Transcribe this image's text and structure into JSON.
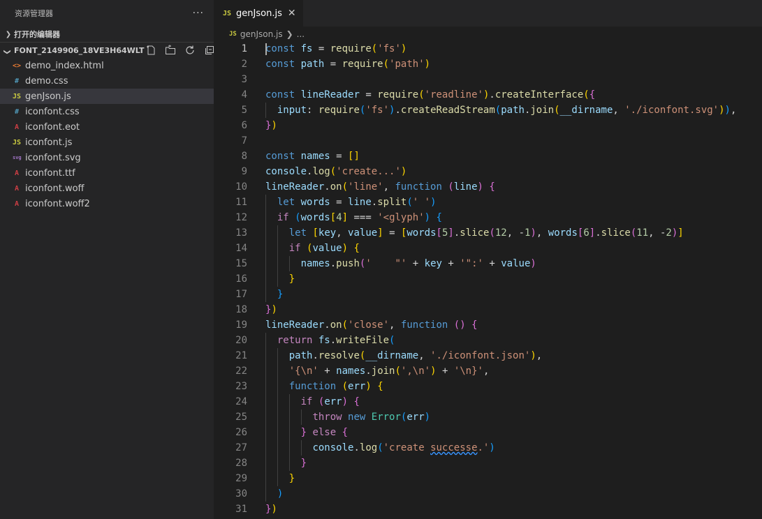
{
  "explorer": {
    "title": "资源管理器",
    "more": "···",
    "open_editors": "打开的编辑器",
    "folder_name": "FONT_2149906_18VE3H64WLT",
    "files": [
      {
        "name": "demo_index.html",
        "icon": "<>",
        "icon_color": "#e37933"
      },
      {
        "name": "demo.css",
        "icon": "#",
        "icon_color": "#519aba"
      },
      {
        "name": "genJson.js",
        "icon": "JS",
        "icon_color": "#cbcb41",
        "active": true
      },
      {
        "name": "iconfont.css",
        "icon": "#",
        "icon_color": "#519aba"
      },
      {
        "name": "iconfont.eot",
        "icon": "A",
        "icon_color": "#cc3e44"
      },
      {
        "name": "iconfont.js",
        "icon": "JS",
        "icon_color": "#cbcb41"
      },
      {
        "name": "iconfont.svg",
        "icon": "svg",
        "icon_color": "#a074c4"
      },
      {
        "name": "iconfont.ttf",
        "icon": "A",
        "icon_color": "#cc3e44"
      },
      {
        "name": "iconfont.woff",
        "icon": "A",
        "icon_color": "#cc3e44"
      },
      {
        "name": "iconfont.woff2",
        "icon": "A",
        "icon_color": "#cc3e44"
      }
    ]
  },
  "editor": {
    "tab_label": "genJson.js",
    "tab_icon": "JS",
    "breadcrumb_file": "genJson.js",
    "breadcrumb_rest": "...",
    "lines": [
      [
        [
          "k",
          "const"
        ],
        [
          "p",
          " "
        ],
        [
          "v",
          "fs"
        ],
        [
          "p",
          " = "
        ],
        [
          "f",
          "require"
        ],
        [
          "b1",
          "("
        ],
        [
          "s",
          "'fs'"
        ],
        [
          "b1",
          ")"
        ]
      ],
      [
        [
          "k",
          "const"
        ],
        [
          "p",
          " "
        ],
        [
          "v",
          "path"
        ],
        [
          "p",
          " = "
        ],
        [
          "f",
          "require"
        ],
        [
          "b1",
          "("
        ],
        [
          "s",
          "'path'"
        ],
        [
          "b1",
          ")"
        ]
      ],
      [],
      [
        [
          "k",
          "const"
        ],
        [
          "p",
          " "
        ],
        [
          "v",
          "lineReader"
        ],
        [
          "p",
          " = "
        ],
        [
          "f",
          "require"
        ],
        [
          "b1",
          "("
        ],
        [
          "s",
          "'readline'"
        ],
        [
          "b1",
          ")"
        ],
        [
          "p",
          "."
        ],
        [
          "f",
          "createInterface"
        ],
        [
          "b1",
          "("
        ],
        [
          "b2",
          "{"
        ]
      ],
      [
        [
          "p",
          "  "
        ],
        [
          "v",
          "input"
        ],
        [
          "p",
          ": "
        ],
        [
          "f",
          "require"
        ],
        [
          "b3",
          "("
        ],
        [
          "s",
          "'fs'"
        ],
        [
          "b3",
          ")"
        ],
        [
          "p",
          "."
        ],
        [
          "f",
          "createReadStream"
        ],
        [
          "b3",
          "("
        ],
        [
          "v",
          "path"
        ],
        [
          "p",
          "."
        ],
        [
          "f",
          "join"
        ],
        [
          "b1",
          "("
        ],
        [
          "v",
          "__dirname"
        ],
        [
          "p",
          ", "
        ],
        [
          "s",
          "'./iconfont.svg'"
        ],
        [
          "b1",
          ")"
        ],
        [
          "b3",
          ")"
        ],
        [
          "p",
          ","
        ]
      ],
      [
        [
          "b2",
          "}"
        ],
        [
          "b1",
          ")"
        ]
      ],
      [],
      [
        [
          "k",
          "const"
        ],
        [
          "p",
          " "
        ],
        [
          "v",
          "names"
        ],
        [
          "p",
          " = "
        ],
        [
          "b1",
          "[]"
        ]
      ],
      [
        [
          "v",
          "console"
        ],
        [
          "p",
          "."
        ],
        [
          "f",
          "log"
        ],
        [
          "b1",
          "("
        ],
        [
          "s",
          "'create...'"
        ],
        [
          "b1",
          ")"
        ]
      ],
      [
        [
          "v",
          "lineReader"
        ],
        [
          "p",
          "."
        ],
        [
          "f",
          "on"
        ],
        [
          "b1",
          "("
        ],
        [
          "s",
          "'line'"
        ],
        [
          "p",
          ", "
        ],
        [
          "k",
          "function"
        ],
        [
          "p",
          " "
        ],
        [
          "b2",
          "("
        ],
        [
          "v",
          "line"
        ],
        [
          "b2",
          ")"
        ],
        [
          "p",
          " "
        ],
        [
          "b2",
          "{"
        ]
      ],
      [
        [
          "p",
          "  "
        ],
        [
          "k",
          "let"
        ],
        [
          "p",
          " "
        ],
        [
          "v",
          "words"
        ],
        [
          "p",
          " = "
        ],
        [
          "v",
          "line"
        ],
        [
          "p",
          "."
        ],
        [
          "f",
          "split"
        ],
        [
          "b3",
          "("
        ],
        [
          "s",
          "' '"
        ],
        [
          "b3",
          ")"
        ]
      ],
      [
        [
          "p",
          "  "
        ],
        [
          "c",
          "if"
        ],
        [
          "p",
          " "
        ],
        [
          "b3",
          "("
        ],
        [
          "v",
          "words"
        ],
        [
          "b1",
          "["
        ],
        [
          "n",
          "4"
        ],
        [
          "b1",
          "]"
        ],
        [
          "p",
          " === "
        ],
        [
          "s",
          "'<glyph'"
        ],
        [
          "b3",
          ")"
        ],
        [
          "p",
          " "
        ],
        [
          "b3",
          "{"
        ]
      ],
      [
        [
          "p",
          "    "
        ],
        [
          "k",
          "let"
        ],
        [
          "p",
          " "
        ],
        [
          "b1",
          "["
        ],
        [
          "v",
          "key"
        ],
        [
          "p",
          ", "
        ],
        [
          "v",
          "value"
        ],
        [
          "b1",
          "]"
        ],
        [
          "p",
          " = "
        ],
        [
          "b1",
          "["
        ],
        [
          "v",
          "words"
        ],
        [
          "b2",
          "["
        ],
        [
          "n",
          "5"
        ],
        [
          "b2",
          "]"
        ],
        [
          "p",
          "."
        ],
        [
          "f",
          "slice"
        ],
        [
          "b2",
          "("
        ],
        [
          "n",
          "12"
        ],
        [
          "p",
          ", -"
        ],
        [
          "n",
          "1"
        ],
        [
          "b2",
          ")"
        ],
        [
          "p",
          ", "
        ],
        [
          "v",
          "words"
        ],
        [
          "b2",
          "["
        ],
        [
          "n",
          "6"
        ],
        [
          "b2",
          "]"
        ],
        [
          "p",
          "."
        ],
        [
          "f",
          "slice"
        ],
        [
          "b2",
          "("
        ],
        [
          "n",
          "11"
        ],
        [
          "p",
          ", -"
        ],
        [
          "n",
          "2"
        ],
        [
          "b2",
          ")"
        ],
        [
          "b1",
          "]"
        ]
      ],
      [
        [
          "p",
          "    "
        ],
        [
          "c",
          "if"
        ],
        [
          "p",
          " "
        ],
        [
          "b1",
          "("
        ],
        [
          "v",
          "value"
        ],
        [
          "b1",
          ")"
        ],
        [
          "p",
          " "
        ],
        [
          "b1",
          "{"
        ]
      ],
      [
        [
          "p",
          "      "
        ],
        [
          "v",
          "names"
        ],
        [
          "p",
          "."
        ],
        [
          "f",
          "push"
        ],
        [
          "b2",
          "("
        ],
        [
          "s",
          "'    \"'"
        ],
        [
          "p",
          " + "
        ],
        [
          "v",
          "key"
        ],
        [
          "p",
          " + "
        ],
        [
          "s",
          "'\":'"
        ],
        [
          "p",
          " + "
        ],
        [
          "v",
          "value"
        ],
        [
          "b2",
          ")"
        ]
      ],
      [
        [
          "p",
          "    "
        ],
        [
          "b1",
          "}"
        ]
      ],
      [
        [
          "p",
          "  "
        ],
        [
          "b3",
          "}"
        ]
      ],
      [
        [
          "b2",
          "}"
        ],
        [
          "b1",
          ")"
        ]
      ],
      [
        [
          "v",
          "lineReader"
        ],
        [
          "p",
          "."
        ],
        [
          "f",
          "on"
        ],
        [
          "b1",
          "("
        ],
        [
          "s",
          "'close'"
        ],
        [
          "p",
          ", "
        ],
        [
          "k",
          "function"
        ],
        [
          "p",
          " "
        ],
        [
          "b2",
          "()"
        ],
        [
          "p",
          " "
        ],
        [
          "b2",
          "{"
        ]
      ],
      [
        [
          "p",
          "  "
        ],
        [
          "c",
          "return"
        ],
        [
          "p",
          " "
        ],
        [
          "v",
          "fs"
        ],
        [
          "p",
          "."
        ],
        [
          "f",
          "writeFile"
        ],
        [
          "b3",
          "("
        ]
      ],
      [
        [
          "p",
          "    "
        ],
        [
          "v",
          "path"
        ],
        [
          "p",
          "."
        ],
        [
          "f",
          "resolve"
        ],
        [
          "b1",
          "("
        ],
        [
          "v",
          "__dirname"
        ],
        [
          "p",
          ", "
        ],
        [
          "s",
          "'./iconfont.json'"
        ],
        [
          "b1",
          ")"
        ],
        [
          "p",
          ","
        ]
      ],
      [
        [
          "p",
          "    "
        ],
        [
          "s",
          "'{\\n'"
        ],
        [
          "p",
          " + "
        ],
        [
          "v",
          "names"
        ],
        [
          "p",
          "."
        ],
        [
          "f",
          "join"
        ],
        [
          "b1",
          "("
        ],
        [
          "s",
          "',\\n'"
        ],
        [
          "b1",
          ")"
        ],
        [
          "p",
          " + "
        ],
        [
          "s",
          "'\\n}'"
        ],
        [
          "p",
          ","
        ]
      ],
      [
        [
          "p",
          "    "
        ],
        [
          "k",
          "function"
        ],
        [
          "p",
          " "
        ],
        [
          "b1",
          "("
        ],
        [
          "v",
          "err"
        ],
        [
          "b1",
          ")"
        ],
        [
          "p",
          " "
        ],
        [
          "b1",
          "{"
        ]
      ],
      [
        [
          "p",
          "      "
        ],
        [
          "c",
          "if"
        ],
        [
          "p",
          " "
        ],
        [
          "b2",
          "("
        ],
        [
          "v",
          "err"
        ],
        [
          "b2",
          ")"
        ],
        [
          "p",
          " "
        ],
        [
          "b2",
          "{"
        ]
      ],
      [
        [
          "p",
          "        "
        ],
        [
          "c",
          "throw"
        ],
        [
          "p",
          " "
        ],
        [
          "k",
          "new"
        ],
        [
          "p",
          " "
        ],
        [
          "t",
          "Error"
        ],
        [
          "b3",
          "("
        ],
        [
          "v",
          "err"
        ],
        [
          "b3",
          ")"
        ]
      ],
      [
        [
          "p",
          "      "
        ],
        [
          "b2",
          "}"
        ],
        [
          "p",
          " "
        ],
        [
          "c",
          "else"
        ],
        [
          "p",
          " "
        ],
        [
          "b2",
          "{"
        ]
      ],
      [
        [
          "p",
          "        "
        ],
        [
          "v",
          "console"
        ],
        [
          "p",
          "."
        ],
        [
          "f",
          "log"
        ],
        [
          "b3",
          "("
        ],
        [
          "s",
          "'create "
        ],
        [
          "sq",
          "successe"
        ],
        [
          "s",
          ".'"
        ],
        [
          "b3",
          ")"
        ]
      ],
      [
        [
          "p",
          "      "
        ],
        [
          "b2",
          "}"
        ]
      ],
      [
        [
          "p",
          "    "
        ],
        [
          "b1",
          "}"
        ]
      ],
      [
        [
          "p",
          "  "
        ],
        [
          "b3",
          ")"
        ]
      ],
      [
        [
          "b2",
          "}"
        ],
        [
          "b1",
          ")"
        ]
      ]
    ]
  }
}
